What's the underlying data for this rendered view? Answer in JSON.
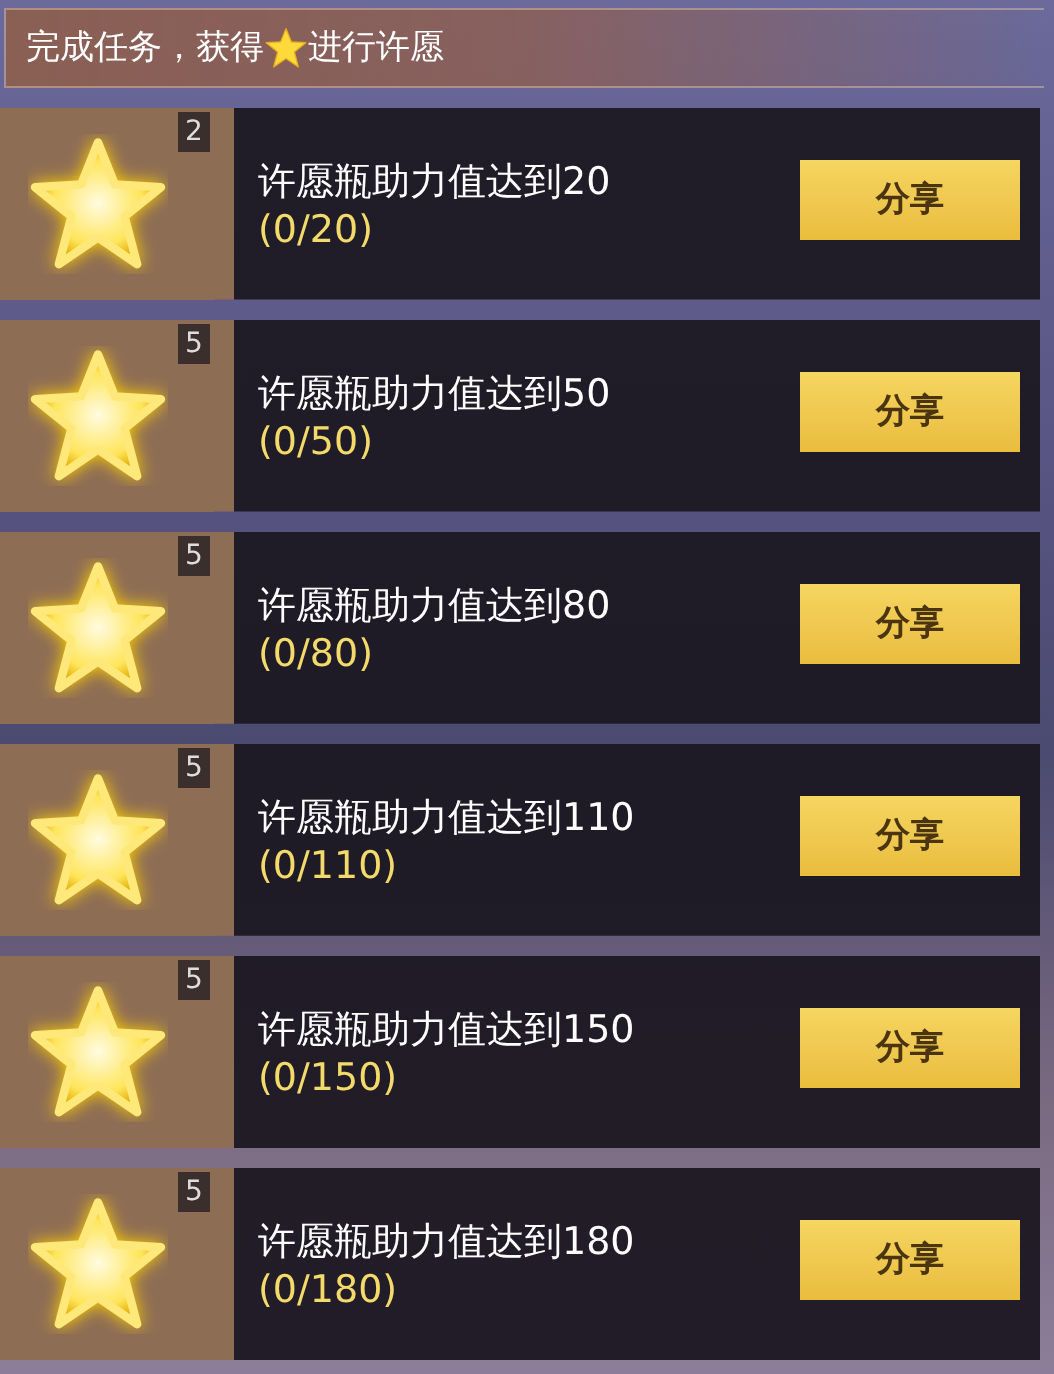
{
  "header": {
    "text_before": "完成任务，获得",
    "text_after": "进行许愿"
  },
  "tasks": [
    {
      "count": "2",
      "title": "许愿瓶助力值达到20",
      "progress": "(0/20)",
      "button": "分享"
    },
    {
      "count": "5",
      "title": "许愿瓶助力值达到50",
      "progress": "(0/50)",
      "button": "分享"
    },
    {
      "count": "5",
      "title": "许愿瓶助力值达到80",
      "progress": "(0/80)",
      "button": "分享"
    },
    {
      "count": "5",
      "title": "许愿瓶助力值达到110",
      "progress": "(0/110)",
      "button": "分享"
    },
    {
      "count": "5",
      "title": "许愿瓶助力值达到150",
      "progress": "(0/150)",
      "button": "分享"
    },
    {
      "count": "5",
      "title": "许愿瓶助力值达到180",
      "progress": "(0/180)",
      "button": "分享"
    }
  ]
}
